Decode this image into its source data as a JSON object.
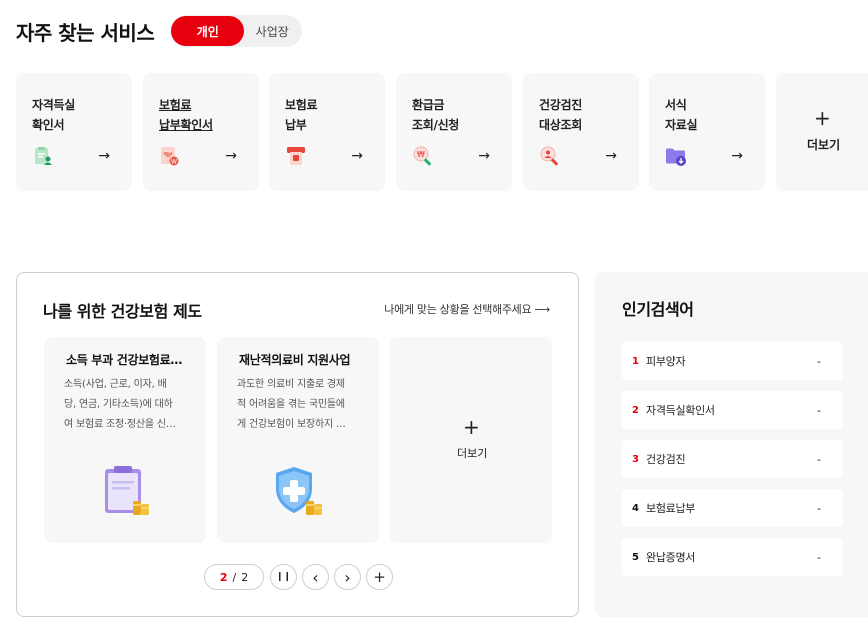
{
  "header": {
    "title": "자주 찾는 서비스",
    "toggle": {
      "active": "개인",
      "inactive": "사업장"
    }
  },
  "services": [
    {
      "lines": [
        "자격득실",
        "확인서"
      ],
      "icon": "certificate-person-icon",
      "arrow": "→"
    },
    {
      "lines": [
        "보험료",
        "납부확인서"
      ],
      "icon": "payment-receipt-icon",
      "arrow": "→"
    },
    {
      "lines": [
        "보험료",
        "납부"
      ],
      "icon": "pay-terminal-icon",
      "arrow": "→"
    },
    {
      "lines": [
        "환급금",
        "조회/신청"
      ],
      "icon": "refund-search-icon",
      "arrow": "→"
    },
    {
      "lines": [
        "건강검진",
        "대상조회"
      ],
      "icon": "person-search-icon",
      "arrow": "→"
    },
    {
      "lines": [
        "서식",
        "자료실"
      ],
      "icon": "folder-download-icon",
      "arrow": "→"
    }
  ],
  "services_more": {
    "plus": "+",
    "label": "더보기"
  },
  "programs": {
    "title": "나를 위한 건강보험 제도",
    "link": "나에게 맞는 상황을 선택해주세요 ⟶",
    "cards": [
      {
        "title": "소득 부과 건강보험료…",
        "desc": [
          "소득(사업, 근로, 이자, 배",
          "당, 연금, 기타소득)에 대하",
          "여 보험료 조정·정산을 신…"
        ],
        "icon": "clipboard-coins-icon"
      },
      {
        "title": "재난적의료비 지원사업",
        "desc": [
          "과도한 의료비 지출로 경제",
          "적 어려움을 겪는 국민들에",
          "게 건강보험이 보장하지 …"
        ],
        "icon": "shield-cross-coins-icon"
      }
    ],
    "more": {
      "plus": "+",
      "label": "더보기"
    },
    "pager": {
      "current": "2",
      "separator": "/",
      "total": "2",
      "pause": "❙❙",
      "prev": "‹",
      "next": "›",
      "add": "+"
    }
  },
  "popular": {
    "title": "인기검색어",
    "items": [
      {
        "rank": "1",
        "text": "피부양자",
        "change": "-"
      },
      {
        "rank": "2",
        "text": "자격득실확인서",
        "change": "-"
      },
      {
        "rank": "3",
        "text": "건강검진",
        "change": "-"
      },
      {
        "rank": "4",
        "text": "보험료납부",
        "change": "-"
      },
      {
        "rank": "5",
        "text": "완납증명서",
        "change": "-"
      }
    ]
  },
  "colors": {
    "accent": "#e8000f",
    "card_bg": "#f7f7f7",
    "border": "#cfcfcf"
  }
}
